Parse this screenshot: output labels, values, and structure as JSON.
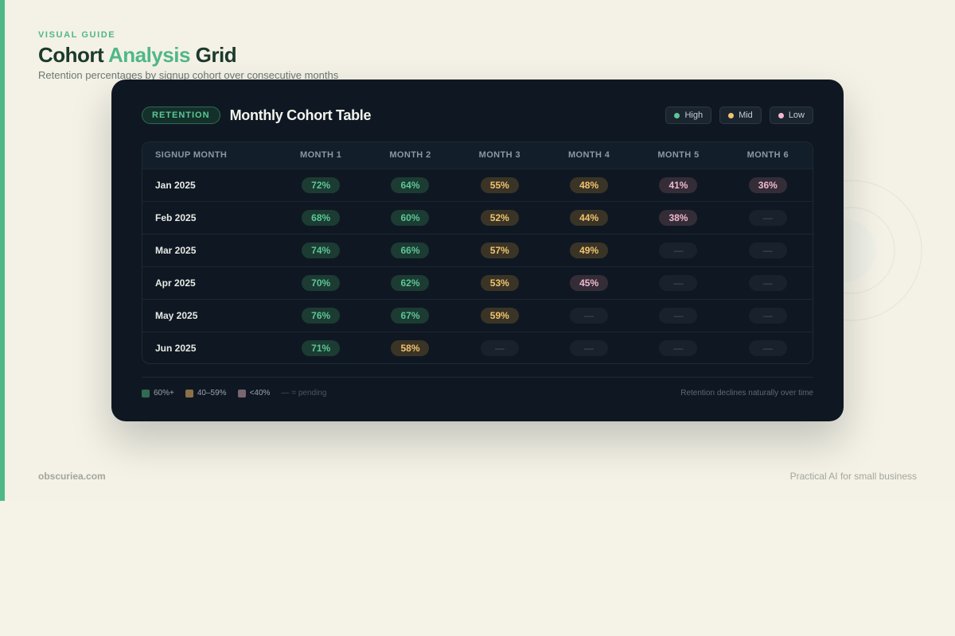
{
  "header": {
    "eyebrow": "VISUAL GUIDE",
    "title_part1": "Cohort ",
    "title_highlight": "Analysis",
    "title_part2": " Grid",
    "subtitle": "Retention percentages by signup cohort over consecutive months"
  },
  "card": {
    "tag": "RETENTION",
    "title": "Monthly Cohort Table",
    "legend": [
      {
        "label": "High",
        "color": "#5cc795"
      },
      {
        "label": "Mid",
        "color": "#f2c46e"
      },
      {
        "label": "Low",
        "color": "#f0b8cf"
      }
    ]
  },
  "table": {
    "columns": [
      "SIGNUP MONTH",
      "MONTH 1",
      "MONTH 2",
      "MONTH 3",
      "MONTH 4",
      "MONTH 5",
      "MONTH 6"
    ],
    "rows": [
      {
        "cohort": "Jan 2025",
        "cells": [
          {
            "v": "72%",
            "t": "high"
          },
          {
            "v": "64%",
            "t": "high"
          },
          {
            "v": "55%",
            "t": "mid"
          },
          {
            "v": "48%",
            "t": "mid"
          },
          {
            "v": "41%",
            "t": "low"
          },
          {
            "v": "36%",
            "t": "low"
          }
        ]
      },
      {
        "cohort": "Feb 2025",
        "cells": [
          {
            "v": "68%",
            "t": "high"
          },
          {
            "v": "60%",
            "t": "high"
          },
          {
            "v": "52%",
            "t": "mid"
          },
          {
            "v": "44%",
            "t": "mid"
          },
          {
            "v": "38%",
            "t": "low"
          },
          {
            "v": "—",
            "t": "pend"
          }
        ]
      },
      {
        "cohort": "Mar 2025",
        "cells": [
          {
            "v": "74%",
            "t": "high"
          },
          {
            "v": "66%",
            "t": "high"
          },
          {
            "v": "57%",
            "t": "mid"
          },
          {
            "v": "49%",
            "t": "mid"
          },
          {
            "v": "—",
            "t": "pend"
          },
          {
            "v": "—",
            "t": "pend"
          }
        ]
      },
      {
        "cohort": "Apr 2025",
        "cells": [
          {
            "v": "70%",
            "t": "high"
          },
          {
            "v": "62%",
            "t": "high"
          },
          {
            "v": "53%",
            "t": "mid"
          },
          {
            "v": "45%",
            "t": "low"
          },
          {
            "v": "—",
            "t": "pend"
          },
          {
            "v": "—",
            "t": "pend"
          }
        ]
      },
      {
        "cohort": "May 2025",
        "cells": [
          {
            "v": "76%",
            "t": "high"
          },
          {
            "v": "67%",
            "t": "high"
          },
          {
            "v": "59%",
            "t": "mid"
          },
          {
            "v": "—",
            "t": "pend"
          },
          {
            "v": "—",
            "t": "pend"
          },
          {
            "v": "—",
            "t": "pend"
          }
        ]
      },
      {
        "cohort": "Jun 2025",
        "cells": [
          {
            "v": "71%",
            "t": "high"
          },
          {
            "v": "58%",
            "t": "mid"
          },
          {
            "v": "—",
            "t": "pend"
          },
          {
            "v": "—",
            "t": "pend"
          },
          {
            "v": "—",
            "t": "pend"
          },
          {
            "v": "—",
            "t": "pend"
          }
        ]
      }
    ]
  },
  "footer_legend": {
    "keys": [
      {
        "label": "60%+",
        "color": "#2f6b50"
      },
      {
        "label": "40–59%",
        "color": "#8a7048"
      },
      {
        "label": "<40%",
        "color": "#7a6570"
      }
    ],
    "pending_note": "— = pending",
    "note": "Retention declines naturally over time"
  },
  "page_footer": {
    "site": "obscuriea.com",
    "tagline": "Practical AI for small business"
  },
  "colors": {
    "accent": "#4fb887",
    "card_bg": "#0f1822",
    "page_bg": "#f4f1e6"
  }
}
